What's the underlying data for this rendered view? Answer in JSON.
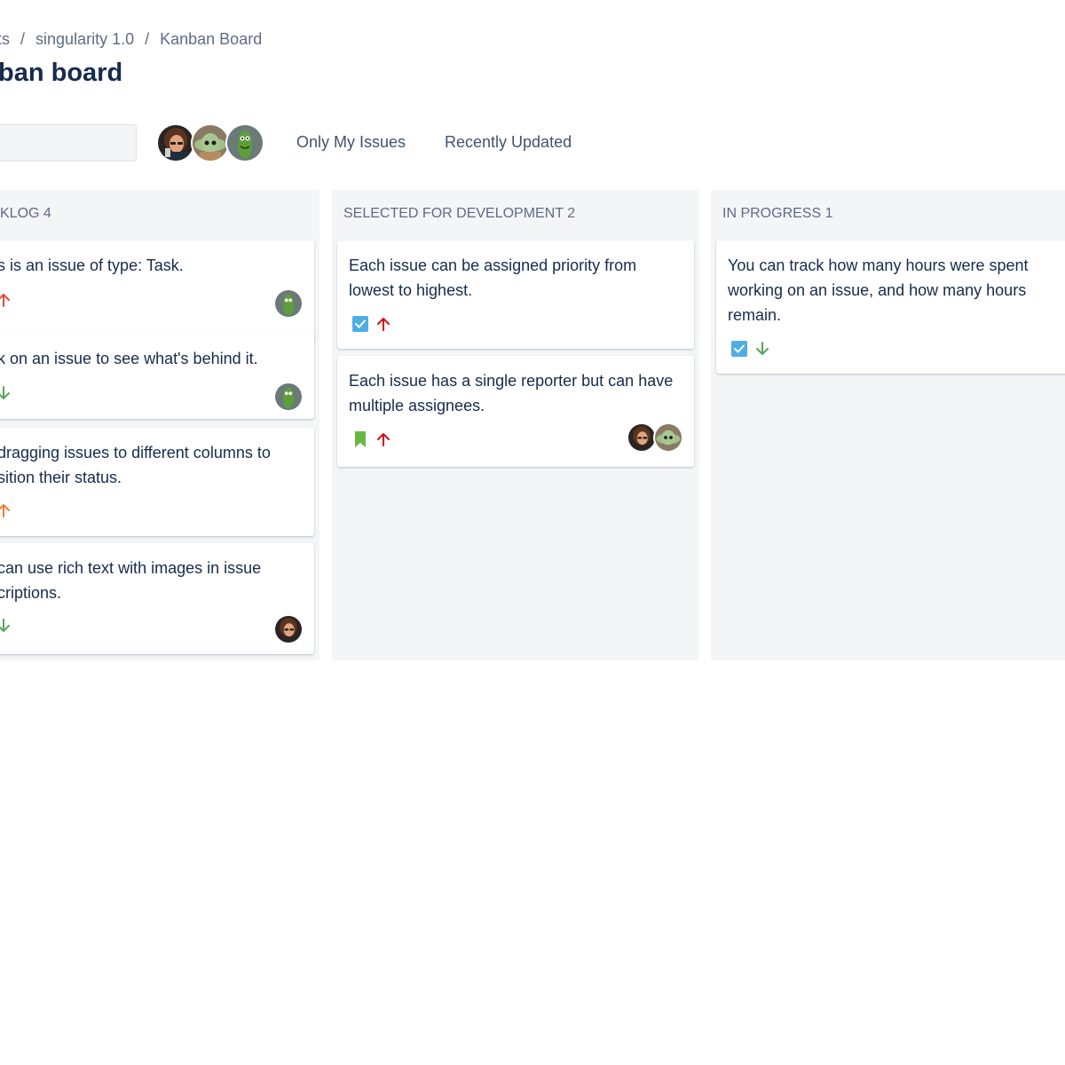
{
  "breadcrumb": {
    "items": [
      "cts",
      "singularity 1.0",
      "Kanban Board"
    ],
    "separator": "/"
  },
  "page_title": "ban board",
  "filters": {
    "only_my_issues": "Only My Issues",
    "recently_updated": "Recently Updated"
  },
  "avatars": [
    "avatar-person-curly-hair",
    "avatar-baby-yoda",
    "avatar-pickle-rick"
  ],
  "colors": {
    "priority_high": "#e5493a",
    "priority_medium": "#e97f33",
    "priority_low": "#57a55a",
    "task_icon": "#4fade6",
    "story_icon": "#65ba43"
  },
  "columns": [
    {
      "title": "KLOG 4",
      "cards": [
        {
          "title": "s is an issue of type: Task.",
          "type": "none",
          "priority": "high",
          "assignees": [
            "avatar-pickle-rick"
          ]
        },
        {
          "title": "k on an issue to see what's behind it.",
          "type": "none",
          "priority": "low",
          "assignees": [
            "avatar-pickle-rick"
          ]
        },
        {
          "title": "dragging issues to different columns to sition their status.",
          "type": "none",
          "priority": "medium",
          "assignees": []
        },
        {
          "title": "can use rich text with images in issue criptions.",
          "type": "none",
          "priority": "low",
          "assignees": [
            "avatar-person-curly-hair"
          ]
        }
      ]
    },
    {
      "title": "SELECTED FOR DEVELOPMENT 2",
      "cards": [
        {
          "title": "Each issue can be assigned priority from lowest to highest.",
          "type": "task",
          "priority": "high",
          "assignees": []
        },
        {
          "title": "Each issue has a single reporter but can have multiple assignees.",
          "type": "story",
          "priority": "high",
          "assignees": [
            "avatar-person-curly-hair",
            "avatar-baby-yoda"
          ]
        }
      ]
    },
    {
      "title": "IN PROGRESS 1",
      "cards": [
        {
          "title": "You can track how many hours were spent working on an issue, and how many hours remain.",
          "type": "task",
          "priority": "low",
          "assignees": []
        }
      ]
    }
  ]
}
